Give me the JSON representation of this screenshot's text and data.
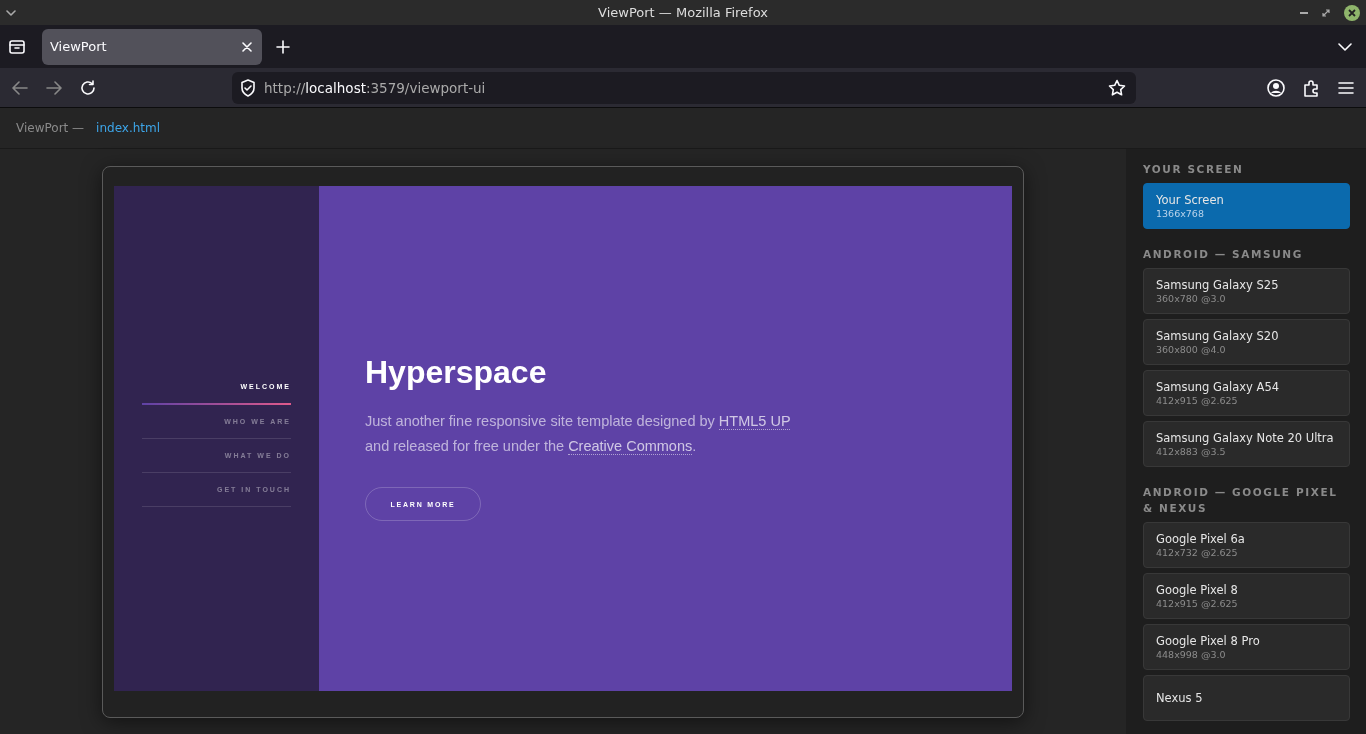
{
  "window": {
    "title": "ViewPort — Mozilla Firefox"
  },
  "tabs": [
    {
      "label": "ViewPort",
      "selected": true
    }
  ],
  "address_bar": {
    "prefix": "http://",
    "host": "localhost",
    "rest": ":3579/viewport-ui"
  },
  "breadcrumb": {
    "app": "ViewPort —",
    "file": "index.html"
  },
  "preview": {
    "nav": [
      {
        "label": "WELCOME",
        "selected": true
      },
      {
        "label": "WHO WE ARE",
        "selected": false
      },
      {
        "label": "WHAT WE DO",
        "selected": false
      },
      {
        "label": "GET IN TOUCH",
        "selected": false
      }
    ],
    "heading": "Hyperspace",
    "description": [
      {
        "kind": "text",
        "text": "Just another fine responsive site template designed by "
      },
      {
        "kind": "link",
        "text": "HTML5 UP"
      },
      {
        "kind": "text",
        "text": " and released for free under the "
      },
      {
        "kind": "link",
        "text": "Creative Commons"
      },
      {
        "kind": "text",
        "text": "."
      }
    ],
    "button": "LEARN MORE"
  },
  "sidebar": {
    "sections": [
      {
        "heading": "YOUR SCREEN",
        "devices": [
          {
            "name": "Your Screen",
            "spec": "1366x768",
            "selected": true
          }
        ]
      },
      {
        "heading": "ANDROID — SAMSUNG",
        "devices": [
          {
            "name": "Samsung Galaxy S25",
            "spec": "360x780 @3.0",
            "selected": false
          },
          {
            "name": "Samsung Galaxy S20",
            "spec": "360x800 @4.0",
            "selected": false
          },
          {
            "name": "Samsung Galaxy A54",
            "spec": "412x915 @2.625",
            "selected": false
          },
          {
            "name": "Samsung Galaxy Note 20 Ultra",
            "spec": "412x883 @3.5",
            "selected": false
          }
        ]
      },
      {
        "heading": "ANDROID — GOOGLE PIXEL & NEXUS",
        "devices": [
          {
            "name": "Google Pixel 6a",
            "spec": "412x732 @2.625",
            "selected": false
          },
          {
            "name": "Google Pixel 8",
            "spec": "412x915 @2.625",
            "selected": false
          },
          {
            "name": "Google Pixel 8 Pro",
            "spec": "448x998 @3.0",
            "selected": false
          },
          {
            "name": "Nexus 5",
            "selected": false
          }
        ]
      }
    ]
  }
}
